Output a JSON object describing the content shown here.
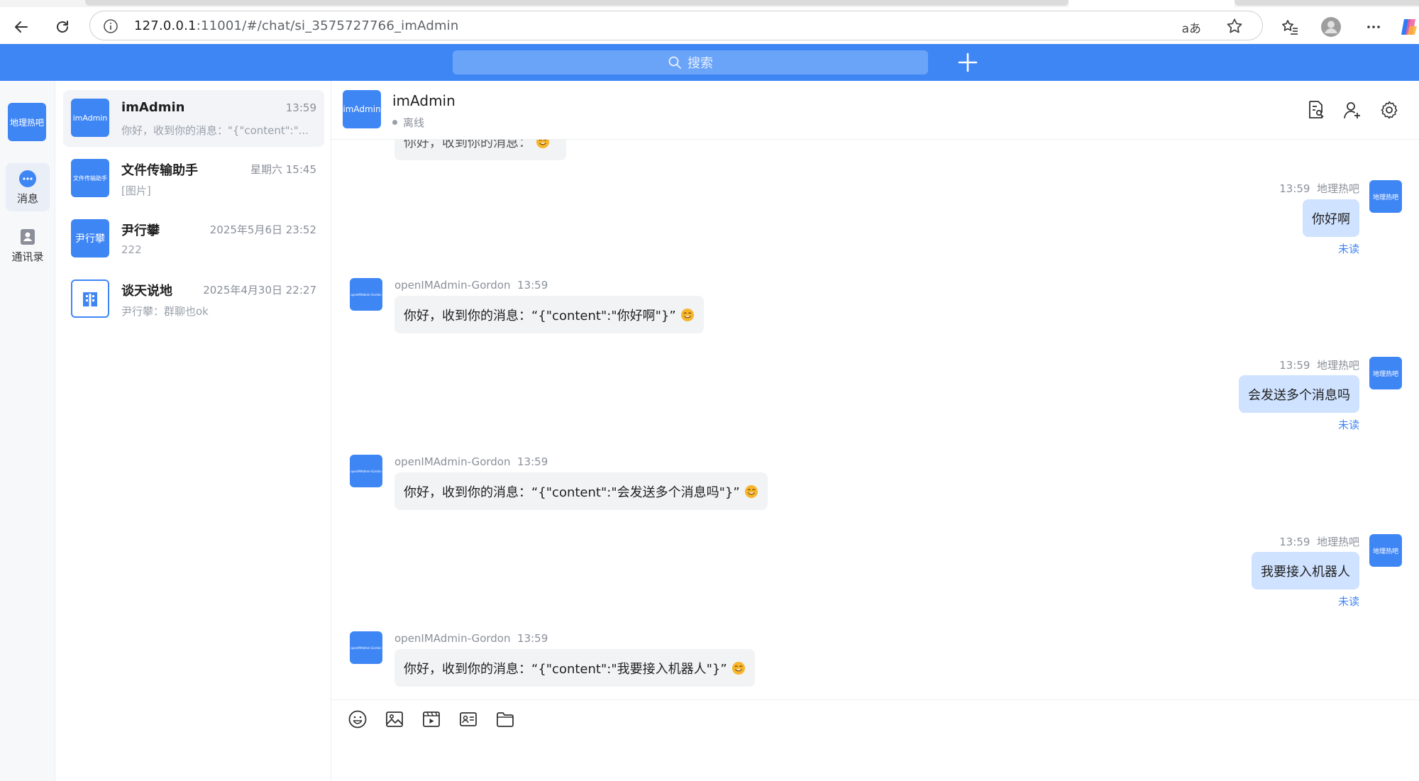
{
  "browser": {
    "url_host": "127.0.0.1",
    "url_path": ":11001/#/chat/si_3575727766_imAdmin",
    "read_aloud": "aあ"
  },
  "header": {
    "search_placeholder": "搜索"
  },
  "rail": {
    "me_label": "地理热吧",
    "nav": [
      {
        "label": "消息"
      },
      {
        "label": "通讯录"
      }
    ]
  },
  "conversations": [
    {
      "name": "imAdmin",
      "time": "13:59",
      "preview": "你好，收到你的消息：\"{\"content\":\"...",
      "avatar": "imAdmin"
    },
    {
      "name": "文件传输助手",
      "time": "星期六 15:45",
      "preview": "[图片]",
      "avatar": "文件传输助手"
    },
    {
      "name": "尹行攀",
      "time": "2025年5月6日 23:52",
      "preview": "222",
      "avatar": "尹行攀"
    },
    {
      "name": "谈天说地",
      "time": "2025年4月30日 22:27",
      "preview": "尹行攀：群聊也ok",
      "avatar": ""
    }
  ],
  "chat": {
    "title": "imAdmin",
    "avatar": "imAdmin",
    "status": "离线",
    "peer_name": "openIMAdmin-Gordon",
    "peer_avatar": "openIMAdmin-Gordon",
    "self_name": "地理热吧",
    "self_avatar": "地理热吧",
    "unread_label": "未读",
    "cut_top_text": "你好，收到你的消息：",
    "messages": [
      {
        "side": "right",
        "time": "13:59",
        "text": "你好啊"
      },
      {
        "side": "left",
        "time": "13:59",
        "text": "你好，收到你的消息：“{\"content\":\"你好啊\"}”"
      },
      {
        "side": "right",
        "time": "13:59",
        "text": "会发送多个消息吗"
      },
      {
        "side": "left",
        "time": "13:59",
        "text": "你好，收到你的消息：“{\"content\":\"会发送多个消息吗\"}”"
      },
      {
        "side": "right",
        "time": "13:59",
        "text": "我要接入机器人"
      },
      {
        "side": "left",
        "time": "13:59",
        "text": "你好，收到你的消息：“{\"content\":\"我要接入机器人\"}”"
      }
    ]
  },
  "colors": {
    "brand": "#3f86f5",
    "self_bubble": "#cfe2ff",
    "peer_bubble": "#f2f3f5"
  }
}
